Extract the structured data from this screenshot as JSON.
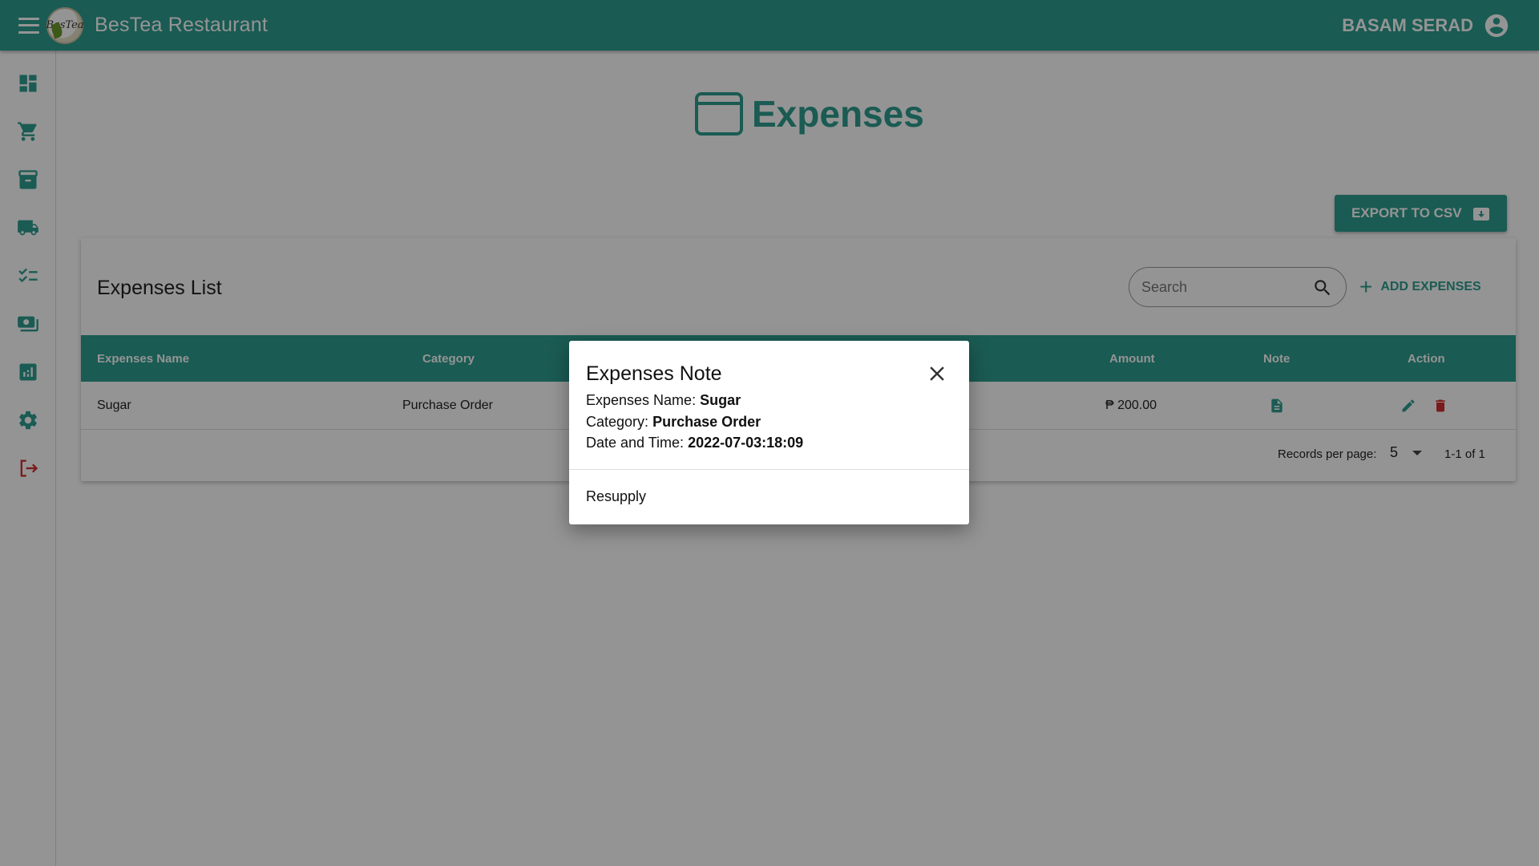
{
  "app": {
    "title": "BesTea Restaurant",
    "logo_text": "BesTea",
    "user_name": "BASAM SERAD"
  },
  "sidebar": {
    "items": [
      {
        "icon": "dashboard-icon"
      },
      {
        "icon": "cart-icon"
      },
      {
        "icon": "archive-icon"
      },
      {
        "icon": "truck-icon"
      },
      {
        "icon": "checklist-icon"
      },
      {
        "icon": "payments-icon"
      },
      {
        "icon": "analytics-icon"
      },
      {
        "icon": "settings-icon"
      },
      {
        "icon": "logout-icon"
      }
    ]
  },
  "page": {
    "title": "Expenses",
    "export_label": "EXPORT TO CSV"
  },
  "card": {
    "title": "Expenses List",
    "search_placeholder": "Search",
    "add_label": "ADD EXPENSES"
  },
  "table": {
    "headers": {
      "name": "Expenses Name",
      "category": "Category",
      "amount": "Amount",
      "note": "Note",
      "action": "Action"
    },
    "rows": [
      {
        "name": "Sugar",
        "category": "Purchase Order",
        "amount": "₱ 200.00"
      }
    ]
  },
  "pagination": {
    "records_label": "Records per page:",
    "per_page": "5",
    "range": "1-1 of 1"
  },
  "dialog": {
    "title": "Expenses Note",
    "name_label": "Expenses Name:",
    "name_value": "Sugar",
    "category_label": "Category:",
    "category_value": "Purchase Order",
    "datetime_label": "Date and Time:",
    "datetime_value": "2022-07-03:18:09",
    "note": "Resupply"
  },
  "colors": {
    "primary": "#2e9d8f",
    "danger": "#d32f2f"
  }
}
